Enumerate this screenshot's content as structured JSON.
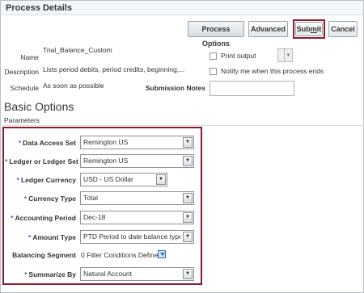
{
  "header": {
    "title": "Process Details"
  },
  "toolbar": {
    "process_options": "Process Options",
    "advanced": "Advanced",
    "submit": "Submit",
    "submit_underline": "m",
    "cancel": "Cancel"
  },
  "details": {
    "name_label": "Name",
    "name_value": "Trial_Balance_Custom",
    "description_label": "Description",
    "description_value": "Lists period debits, period credits, beginning,...",
    "schedule_label": "Schedule",
    "schedule_value": "As soon as possible",
    "print_output_label": "Print output",
    "notify_label": "Notify me when this process ends",
    "submission_notes_label": "Submission Notes"
  },
  "basic_options": {
    "title": "Basic Options",
    "parameters_label": "Parameters",
    "params": [
      {
        "label": "Data Access Set",
        "value": "Remington US",
        "required": true
      },
      {
        "label": "Ledger or Ledger Set",
        "value": "Remington US",
        "required": true
      },
      {
        "label": "Ledger Currency",
        "value": "USD - US Dollar",
        "required": true
      },
      {
        "label": "Currency Type",
        "value": "Total",
        "required": true
      },
      {
        "label": "Accounting Period",
        "value": "Dec-18",
        "required": true
      },
      {
        "label": "Amount Type",
        "value": "PTD Period to date balance type.",
        "required": true
      },
      {
        "label": "Balancing Segment",
        "value": "0 Filter Conditions Defined",
        "required": false
      },
      {
        "label": "Summarize By",
        "value": "Natural Account",
        "required": true
      }
    ]
  },
  "colors": {
    "highlight": "#8a1c2c",
    "required_star": "#3a6fb0"
  },
  "icons": {
    "dropdown": "chevron-down-icon",
    "filter": "filter-icon"
  }
}
